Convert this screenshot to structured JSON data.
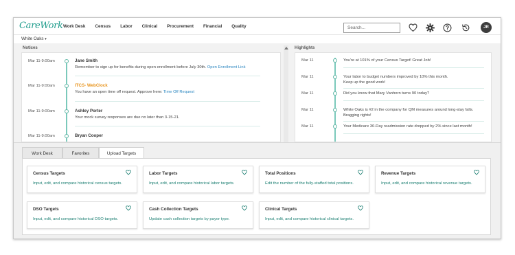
{
  "app": {
    "logo": "CareWork"
  },
  "nav": {
    "items": [
      "Work Desk",
      "Census",
      "Labor",
      "Clinical",
      "Procurement",
      "Financial",
      "Quality"
    ]
  },
  "search": {
    "placeholder": "Search..."
  },
  "user": {
    "initials": "JR"
  },
  "org": {
    "name": "White Oaks",
    "caret": "▾"
  },
  "notices": {
    "label": "Notices",
    "items": [
      {
        "date": "Mar 11-9:00am",
        "title": "Jane Smith",
        "text": "Remember to sign up for benefits during open enrollment before July 30th.",
        "link": "Open Enrollment Link",
        "orange": false
      },
      {
        "date": "Mar 11-9:00am",
        "title": "ITCS- WebClock",
        "text": "You have an open time off request.  Approve here:",
        "link": "Time Off Request",
        "orange": true
      },
      {
        "date": "Mar 11-9:00am",
        "title": "Ashley Porter",
        "text": "Your mock survey responses are due no later than 3-15-21.",
        "link": "",
        "orange": false
      },
      {
        "date": "Mar 11-9:00am",
        "title": "Bryan Cooper",
        "text": "",
        "link": "",
        "orange": false
      }
    ]
  },
  "highlights": {
    "label": "Highlights",
    "items": [
      {
        "date": "Mar 11",
        "text": "You're at 101% of your Census Target!  Great Job!",
        "text2": ""
      },
      {
        "date": "Mar 11",
        "text": "Your labor to budget numbers improved by 10% this month.",
        "text2": "Keep up the good work!"
      },
      {
        "date": "Mar 11",
        "text": "Did you know that Mary Vanhorn turns 90 today?",
        "text2": ""
      },
      {
        "date": "Mar 11",
        "text": "White Oaks is #2 in the company for QM measures around long-stay falls.",
        "text2": "Bragging rights!"
      },
      {
        "date": "Mar 11",
        "text": "Your Medicare 30-Day readmission rate dropped by 2% since last month!",
        "text2": ""
      }
    ]
  },
  "tabs": {
    "items": [
      "Work Desk",
      "Favorites",
      "Upload Targets"
    ],
    "active": "Upload Targets"
  },
  "cards": [
    {
      "title": "Census Targets",
      "desc": "Input, edit, and compare historical census targets."
    },
    {
      "title": "Labor Targets",
      "desc": "Input, edit, and compare historical labor targets."
    },
    {
      "title": "Total Positions",
      "desc": "Edit the number of the fully-staffed total positions."
    },
    {
      "title": "Revenue Targets",
      "desc": "Input, edit, and compare historical revenue targets."
    },
    {
      "title": "DSO Targets",
      "desc": "Input, edit, and compare historical DSO targets."
    },
    {
      "title": "Cash Collection Targets",
      "desc": "Update cash collection targets by payor type."
    },
    {
      "title": "Clinical Targets",
      "desc": "Input, edit, and compare historical clinical targets."
    }
  ],
  "colors": {
    "brand": "#1f9c8c",
    "timeline": "#7bc9bb",
    "link": "#2a86c0",
    "orange": "#e8951f",
    "card_desc": "#1c7f72"
  },
  "icons": [
    "heart-icon",
    "gear-icon",
    "help-icon",
    "history-icon",
    "caret-down-icon",
    "scroll-up-icon",
    "favorite-heart-icon"
  ]
}
